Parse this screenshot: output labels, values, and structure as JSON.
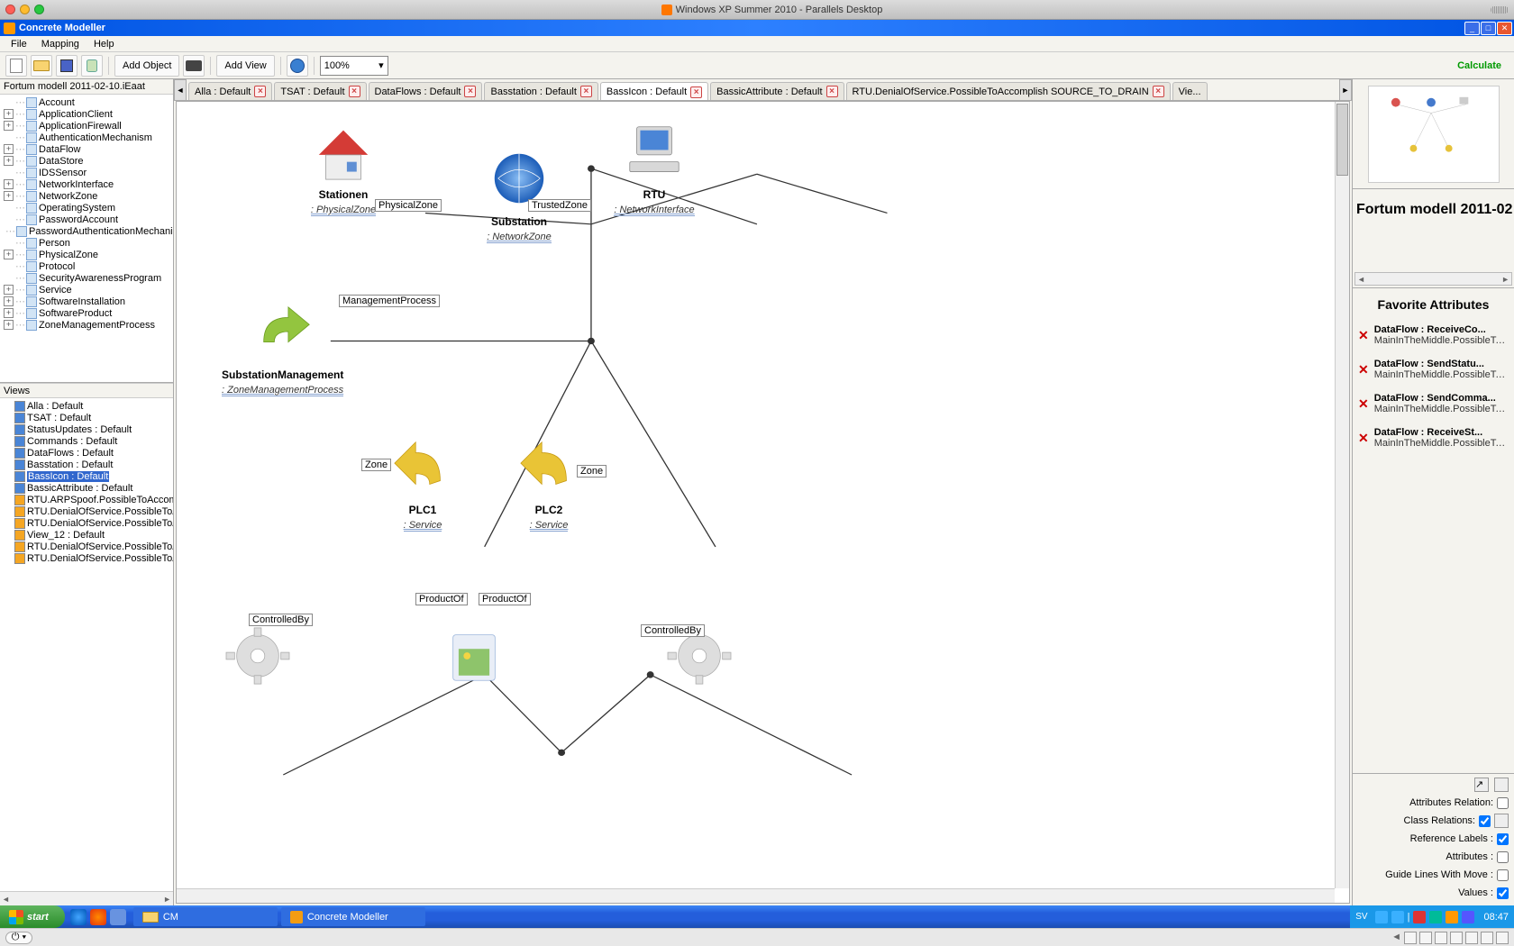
{
  "mac": {
    "title": "Windows XP Summer 2010 - Parallels Desktop"
  },
  "win": {
    "title": "Concrete Modeller"
  },
  "menu": [
    "File",
    "Mapping",
    "Help"
  ],
  "toolbar": {
    "addObject": "Add Object",
    "addView": "Add View",
    "zoom": "100%",
    "calculate": "Calculate"
  },
  "modelTree": {
    "root": "Fortum modell 2011-02-10.iEaat",
    "items": [
      "Account",
      "ApplicationClient",
      "ApplicationFirewall",
      "AuthenticationMechanism",
      "DataFlow",
      "DataStore",
      "IDSSensor",
      "NetworkInterface",
      "NetworkZone",
      "OperatingSystem",
      "PasswordAccount",
      "PasswordAuthenticationMechanism",
      "Person",
      "PhysicalZone",
      "Protocol",
      "SecurityAwarenessProgram",
      "Service",
      "SoftwareInstallation",
      "SoftwareProduct",
      "ZoneManagementProcess"
    ]
  },
  "viewsHeader": "Views",
  "views": [
    "Alla : Default",
    "TSAT : Default",
    "StatusUpdates : Default",
    "Commands : Default",
    "DataFlows : Default",
    "Basstation : Default",
    "BassIcon : Default",
    "BassicAttribute : Default",
    "RTU.ARPSpoof.PossibleToAccomplish IM",
    "RTU.DenialOfService.PossibleToAccomp",
    "RTU.DenialOfService.PossibleToAccomp",
    "View_12 : Default",
    "RTU.DenialOfService.PossibleToAccomp",
    "RTU.DenialOfService.PossibleToAccomp"
  ],
  "viewsSelected": 6,
  "tabs": [
    "Alla : Default",
    "TSAT : Default",
    "DataFlows : Default",
    "Basstation : Default",
    "BassIcon : Default",
    "BassicAttribute : Default",
    "RTU.DenialOfService.PossibleToAccomplish SOURCE_TO_DRAIN",
    "Vie..."
  ],
  "tabsActive": 4,
  "canvas": {
    "nodes": {
      "stationen": {
        "title": "Stationen",
        "sub": ": PhysicalZone"
      },
      "substation": {
        "title": "Substation",
        "sub": ": NetworkZone"
      },
      "rtu": {
        "title": "RTU",
        "sub": ": NetworkInterface"
      },
      "submgmt": {
        "title": "SubstationManagement",
        "sub": ": ZoneManagementProcess"
      },
      "plc1": {
        "title": "PLC1",
        "sub": ": Service"
      },
      "plc2": {
        "title": "PLC2",
        "sub": ": Service"
      }
    },
    "edgeLabels": {
      "physicalZone": "PhysicalZone",
      "trustedZone": "TrustedZone",
      "mgmtProcess": "ManagementProcess",
      "zoneL": "Zone",
      "zoneR": "Zone",
      "productOfL": "ProductOf",
      "productOfR": "ProductOf",
      "controlledByL": "ControlledBy",
      "controlledByR": "ControlledBy"
    }
  },
  "projectTitle": "Fortum modell 2011-02",
  "fav": {
    "title": "Favorite Attributes",
    "items": [
      {
        "t1": "DataFlow : ReceiveCo...",
        "t2": "MainInTheMiddle.PossibleToA..."
      },
      {
        "t1": "DataFlow : SendStatu...",
        "t2": "MainInTheMiddle.PossibleToA..."
      },
      {
        "t1": "DataFlow : SendComma...",
        "t2": "MainInTheMiddle.PossibleToA..."
      },
      {
        "t1": "DataFlow : ReceiveSt...",
        "t2": "MainInTheMiddle.PossibleToA..."
      }
    ]
  },
  "opts": {
    "attrRel": "Attributes Relation:",
    "classRel": "Class Relations:",
    "refLabels": "Reference Labels :",
    "attrs": "Attributes :",
    "guide": "Guide Lines With Move :",
    "vals": "Values :"
  },
  "taskbar": {
    "start": "start",
    "tasks": [
      "CM",
      "Concrete Modeller"
    ],
    "lang": "SV",
    "clock": "08:47"
  }
}
